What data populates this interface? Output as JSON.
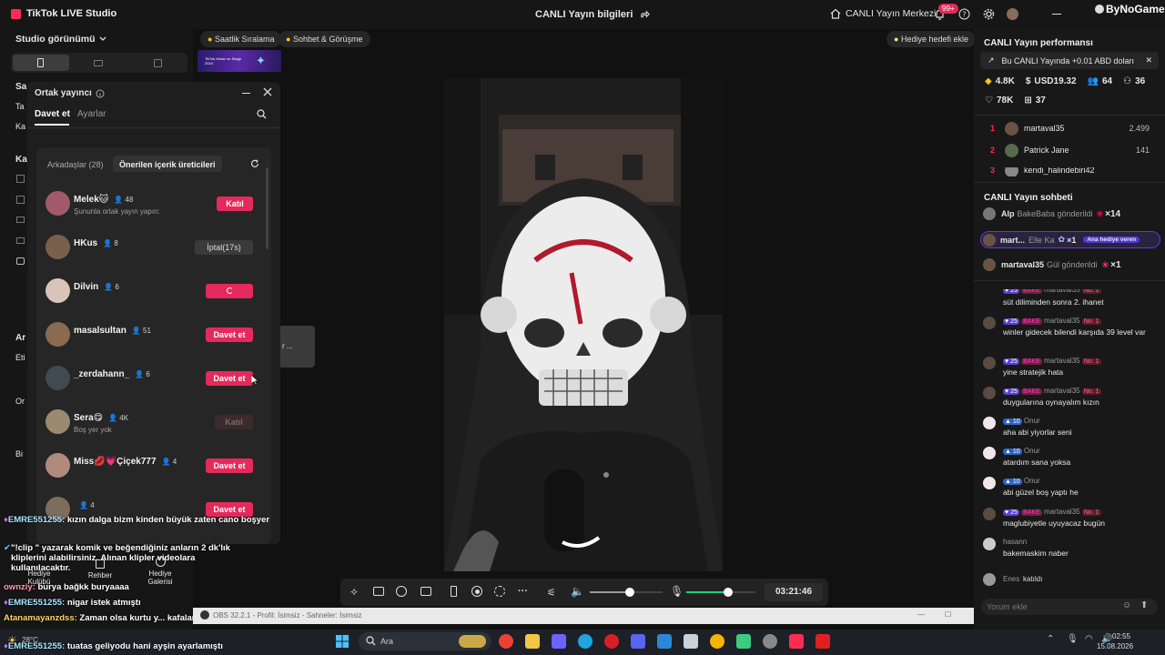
{
  "titlebar": {
    "app_title": "TikTok LIVE Studio",
    "center_title": "CANLI Yayın bilgileri",
    "creator_center": "CANLI Yayın Merkezi",
    "notification_count": "99+",
    "watermark": "ByNoGame"
  },
  "left_panel": {
    "studio_view": "Studio görünümü",
    "partial_labels": [
      "Sa",
      "Ta",
      "Ka",
      "Ka",
      "Ar",
      "Eti",
      "Or",
      "Bi"
    ]
  },
  "stage": {
    "pills": [
      "Saatlik Sıralama",
      "Sohbet & Görüşme"
    ],
    "gift_goal": "Hediye hedefi ekle",
    "banner_text": "TikTok Music on Stage 2024"
  },
  "dialog": {
    "title": "Ortak yayıncı",
    "tabs": [
      "Davet et",
      "Ayarlar"
    ],
    "subtabs": [
      "Arkadaşlar (28)",
      "Önerilen içerik üreticileri"
    ],
    "creators": [
      {
        "name": "Melek🐱",
        "count": "48",
        "sub": "Şununla ortak yayın yapın:",
        "button": "Katıl",
        "style": "red"
      },
      {
        "name": "HKus",
        "count": "8",
        "sub": "",
        "button": "İptal(17s)",
        "style": "gray"
      },
      {
        "name": "Dilvin",
        "count": "6",
        "sub": "",
        "button": "",
        "style": "red"
      },
      {
        "name": "masalsultan",
        "count": "51",
        "sub": "",
        "button": "Davet et",
        "style": "red"
      },
      {
        "name": "_zerdahann_",
        "count": "6",
        "sub": "",
        "button": "Davet et",
        "style": "red"
      },
      {
        "name": "Sera😋",
        "count": "4K",
        "sub": "Boş yer yok",
        "button": "Katıl",
        "style": "dim"
      },
      {
        "name": "Miss💋💗Çiçek777",
        "count": "4",
        "sub": "",
        "button": "Davet et",
        "style": "red"
      },
      {
        "name": "",
        "count": "4",
        "sub": "",
        "button": "Davet et",
        "style": "red"
      }
    ]
  },
  "tooltip_partial": "r ...",
  "overlay_chat": [
    {
      "name": "EMRE551255:",
      "text": "kızın dalga bizm kinden büyük zaten cano boşyer"
    },
    {
      "name": "",
      "text": "\"!clip \" yazarak komik ve beğendiğiniz anların 2 dk'lık kliplerini alabilirsiniz. Alınan klipler videolara kullanılacaktır."
    },
    {
      "name": "ownziy:",
      "text": "burya bağkk buryaaaa"
    },
    {
      "name": "EMRE551255:",
      "text": "nigar istek atmıştı"
    },
    {
      "name": "Atanamayanzdss:",
      "text": "Zaman olsa kurtu y... kafalarına"
    },
    {
      "name": "EMRE551255:",
      "text": "tuatas geliyodu hani ayşin ayarlamıştı"
    }
  ],
  "left_bottom_buttons": [
    "Hediye Kulübü",
    "Rehber",
    "Hediye Galerisi"
  ],
  "weather": "28°C",
  "toolbar": {
    "timer": "03:21:46",
    "volume": 0.55,
    "mic": 0.6
  },
  "obs_bar": "OBS 32.2.1 - Profil: İsimsiz - Sahneler: İsimsiz",
  "right_panel": {
    "performance_title": "CANLI Yayın performansı",
    "earning_note": "Bu CANLI Yayında +0.01 ABD doları",
    "stats": {
      "coins": "4.8K",
      "usd": "USD19.32",
      "viewers": "64",
      "new_followers": "36",
      "likes": "78K",
      "gifters": "37"
    },
    "leaderboard": [
      {
        "rank": "1",
        "name": "martaval35",
        "score": "2.499"
      },
      {
        "rank": "2",
        "name": "Patrick Jane",
        "score": "141"
      },
      {
        "rank": "3",
        "name": "kendi_halindebiri42",
        "score": ""
      }
    ],
    "chat_title": "CANLI Yayın sohbeti",
    "gift_events": [
      {
        "name": "Alp",
        "text": "BakeBaba gönderildi",
        "mult": "×14"
      },
      {
        "name": "mart...",
        "text": "Elle Ka",
        "mult": "×1",
        "tag": "Ana hediye veren"
      },
      {
        "name": "martaval35",
        "text": "Gül gönderildi",
        "mult": "×1"
      }
    ],
    "messages": [
      {
        "meta": "25 BAKE martaval35 No. 1",
        "text": "süt diliminden sonra 2. ihanet"
      },
      {
        "meta": "25 BAKE martaval35 No. 1",
        "text": "winler gidecek bilendi karşıda 39 level var"
      },
      {
        "meta": "25 BAKE martaval35 No. 1",
        "text": "yine stratejik hata"
      },
      {
        "meta": "25 BAKE martaval35 No. 1",
        "text": "duygularına oynayalım kızın"
      },
      {
        "meta": "10 Onur",
        "text": "aha abi yiyorlar seni"
      },
      {
        "meta": "10 Onur",
        "text": "atardım sana yoksa"
      },
      {
        "meta": "10 Onur",
        "text": "abi güzel boş yaptı he"
      },
      {
        "meta": "25 BAKE martaval35 No. 1",
        "text": "maglubiyetle uyuyacaz bugün"
      },
      {
        "meta": "hasann",
        "text": "bakemaskim naber"
      },
      {
        "meta": "Enes",
        "text": "katıldı"
      }
    ],
    "comment_placeholder": "Yorum ekle"
  },
  "taskbar": {
    "search": "Ara",
    "time": "02:55",
    "date": "15.08.2026"
  }
}
